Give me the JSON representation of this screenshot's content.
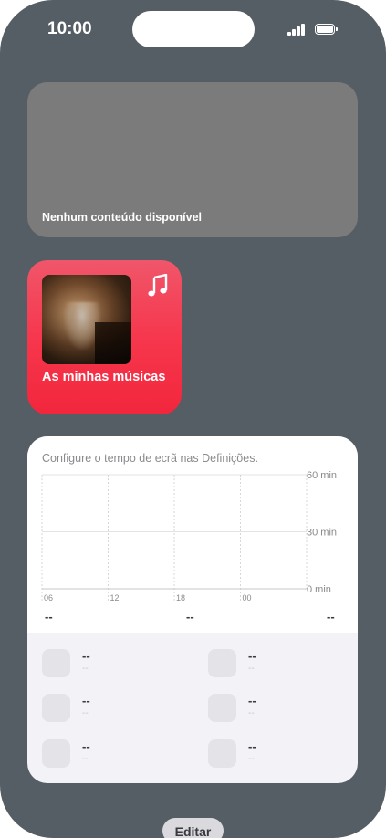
{
  "status_bar": {
    "time": "10:00",
    "signal_icon": "cellular-signal-icon",
    "battery_icon": "battery-icon"
  },
  "widgets": {
    "empty": {
      "label": "Nenhum conteúdo disponível"
    },
    "music": {
      "label": "As minhas músicas",
      "icon": "music-note-icon",
      "bg_color": "#f6374d"
    },
    "screen_time": {
      "caption": "Configure o tempo de ecrã nas Definições.",
      "summary": [
        "--",
        "--",
        "--"
      ],
      "apps": [
        {
          "name": "--",
          "time": "--"
        },
        {
          "name": "--",
          "time": "--"
        },
        {
          "name": "--",
          "time": "--"
        },
        {
          "name": "--",
          "time": "--"
        },
        {
          "name": "--",
          "time": "--"
        },
        {
          "name": "--",
          "time": "--"
        }
      ]
    }
  },
  "chart_data": {
    "type": "bar",
    "categories": [
      "06",
      "12",
      "18",
      "00"
    ],
    "values": [],
    "title": "",
    "xlabel": "",
    "ylabel": "",
    "ylim": [
      0,
      60
    ],
    "y_tick_labels": [
      "60 min",
      "30 min",
      "0 min"
    ],
    "grid": true
  },
  "footer": {
    "edit_label": "Editar"
  },
  "colors": {
    "background": "#565e65",
    "widget_gray": "#7b7b7b",
    "accent_red": "#f6374d"
  }
}
